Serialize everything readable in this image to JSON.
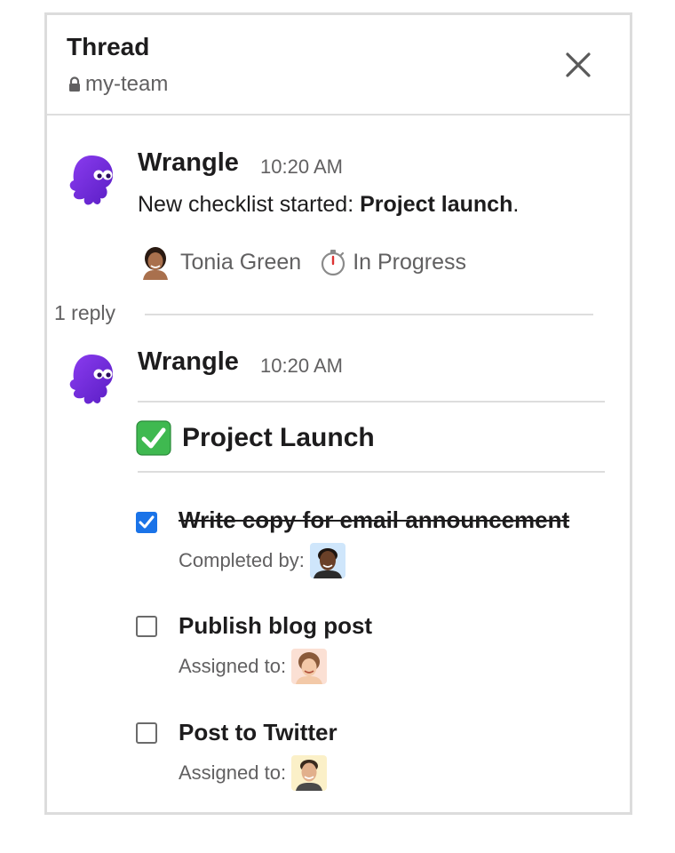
{
  "header": {
    "title": "Thread",
    "channel": "my-team"
  },
  "parent_message": {
    "sender": "Wrangle",
    "time": "10:20 AM",
    "text_prefix": "New checklist started: ",
    "text_bold": "Project launch",
    "text_suffix": ".",
    "assignee": "Tonia Green",
    "status": "In Progress"
  },
  "replies": {
    "count_label": "1 reply"
  },
  "reply_message": {
    "sender": "Wrangle",
    "time": "10:20 AM",
    "checklist_title": "Project Launch",
    "items": [
      {
        "label": "Write copy for email announcement",
        "checked": true,
        "meta_label": "Completed by:"
      },
      {
        "label": "Publish blog post",
        "checked": false,
        "meta_label": "Assigned to:"
      },
      {
        "label": "Post to Twitter",
        "checked": false,
        "meta_label": "Assigned to:"
      }
    ]
  },
  "colors": {
    "brand_purple": "#6c2bd9",
    "checkbox_blue": "#1a73e8",
    "check_green": "#3fb950"
  },
  "icons": [
    "lock-icon",
    "close-icon",
    "octopus-avatar",
    "stopwatch-icon",
    "check-mark-emoji",
    "checkbox-checked",
    "checkbox-empty"
  ]
}
